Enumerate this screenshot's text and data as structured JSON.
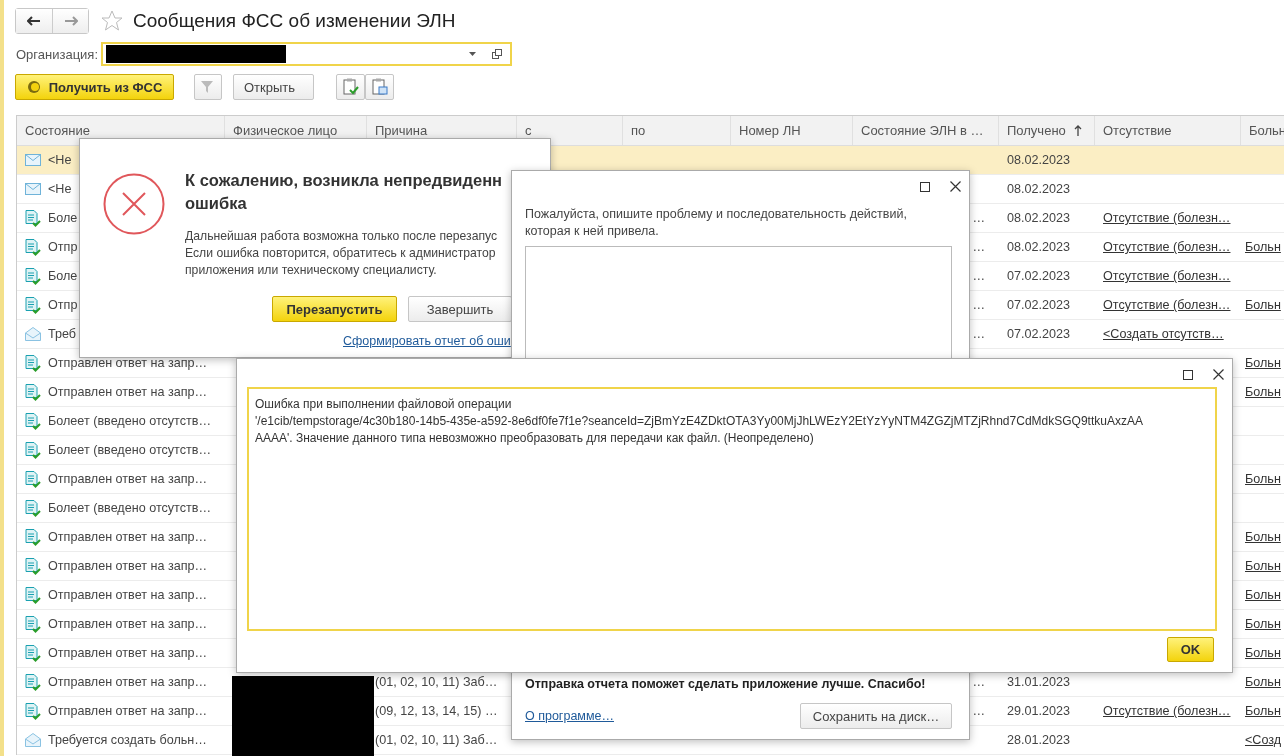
{
  "title": "Сообщения ФСС об изменении ЭЛН",
  "organization": {
    "label": "Организация:"
  },
  "toolbar": {
    "fetch_button": "Получить из ФСС",
    "open_button": "Открыть"
  },
  "table": {
    "columns": [
      {
        "label": "Состояние"
      },
      {
        "label": "Физическое лицо"
      },
      {
        "label": "Причина"
      },
      {
        "label": "с"
      },
      {
        "label": "по"
      },
      {
        "label": "Номер ЛН"
      },
      {
        "label": "Состояние ЭЛН в …"
      },
      {
        "label": "Получено",
        "sorted": true
      },
      {
        "label": "Отсутствие"
      },
      {
        "label": "Больн"
      }
    ],
    "rows": [
      {
        "kind": "envelope",
        "state": "<Не",
        "received": "08.02.2023",
        "selected": true
      },
      {
        "kind": "envelope",
        "state": "<Не",
        "received": "08.02.2023",
        "selected": false
      },
      {
        "kind": "document",
        "state": "Боле",
        "eln_state": "…",
        "received": "08.02.2023",
        "absence": "Отсутствие (болезн…",
        "selected": false
      },
      {
        "kind": "document",
        "state": "Отпр",
        "eln_state": "…",
        "received": "08.02.2023",
        "absence": "Отсутствие (болезн…",
        "sick": "Больн",
        "selected": false
      },
      {
        "kind": "document",
        "state": "Боле",
        "eln_state": "…",
        "received": "07.02.2023",
        "absence": "Отсутствие (болезн…",
        "selected": false
      },
      {
        "kind": "document",
        "state": "Отпр",
        "eln_state": "…",
        "received": "07.02.2023",
        "absence": "Отсутствие (болезн…",
        "sick": "Больн",
        "selected": false
      },
      {
        "kind": "open-envelope",
        "state": "Треб",
        "eln_state": "…",
        "received": "07.02.2023",
        "absence": "<Создать отсутств…",
        "selected": false
      },
      {
        "kind": "document",
        "state": "Отправлен ответ на запр…",
        "sick": "Больн",
        "selected": false
      },
      {
        "kind": "document",
        "state": "Отправлен ответ на запр…",
        "sick": "Больн",
        "selected": false
      },
      {
        "kind": "document",
        "state": "Болеет (введено отсутств…",
        "selected": false
      },
      {
        "kind": "document",
        "state": "Болеет (введено отсутств…",
        "selected": false
      },
      {
        "kind": "document",
        "state": "Отправлен ответ на запр…",
        "sick": "Больн",
        "selected": false
      },
      {
        "kind": "document",
        "state": "Болеет (введено отсутств…",
        "selected": false
      },
      {
        "kind": "document",
        "state": "Отправлен ответ на запр…",
        "sick": "Больн",
        "selected": false
      },
      {
        "kind": "document",
        "state": "Отправлен ответ на запр…",
        "sick": "Больн",
        "selected": false
      },
      {
        "kind": "document",
        "state": "Отправлен ответ на запр…",
        "sick": "Больн",
        "selected": false
      },
      {
        "kind": "document",
        "state": "Отправлен ответ на запр…",
        "sick": "Больн",
        "selected": false
      },
      {
        "kind": "document",
        "state": "Отправлен ответ на запр…",
        "sick": "Больн",
        "selected": false
      },
      {
        "kind": "document",
        "state": "Отправлен ответ на запр…",
        "reason": "(01, 02, 10, 11) Заб…",
        "eln_state": "…",
        "received": "31.01.2023",
        "sick": "Больн",
        "selected": false
      },
      {
        "kind": "document",
        "state": "Отправлен ответ на запр…",
        "reason": "(09, 12, 13, 14, 15) …",
        "eln_state": "…",
        "received": "29.01.2023",
        "absence": "Отсутствие (болезн…",
        "sick": "Больн",
        "selected": false
      },
      {
        "kind": "open-envelope",
        "state": "Требуется создать больн…",
        "reason": "(01, 02, 10, 11) Заб…",
        "received": "28.01.2023",
        "sick": "<Созд",
        "selected": false
      }
    ]
  },
  "error_dialog": {
    "title_lines": [
      "К сожалению, возникла непредвиденн",
      "ошибка"
    ],
    "message_lines": [
      "Дальнейшая работа возможна только после перезапус",
      "Если ошибка повторится, обратитесь к администратор",
      "приложения или техническому специалисту."
    ],
    "restart_button": "Перезапустить",
    "finish_button": "Завершить",
    "report_link": "Сформировать отчет об оши"
  },
  "report_dialog": {
    "prompt": "Пожалуйста, опишите проблему и последовательность действий, которая к ней привела.",
    "thanks": "Отправка отчета поможет сделать приложение лучше. Спасибо!",
    "about_link": "О программе…",
    "save_button": "Сохранить на диск…"
  },
  "message_dialog": {
    "lines": [
      "Ошибка при выполнении файловой операции",
      "'/e1cib/tempstorage/4c30b180-14b5-435e-a592-8e6df0fe7f1e?seanceId=ZjBmYzE4ZDktOTA3Yy00MjJhLWEzY2EtYzYyNTM4ZGZjMTZjRhnd7CdMdkSGQ9ttkuAxzAA",
      "AAAA'. Значение данного типа невозможно преобразовать для передачи как файл. (Неопределено)"
    ],
    "ok_button": "OK"
  }
}
